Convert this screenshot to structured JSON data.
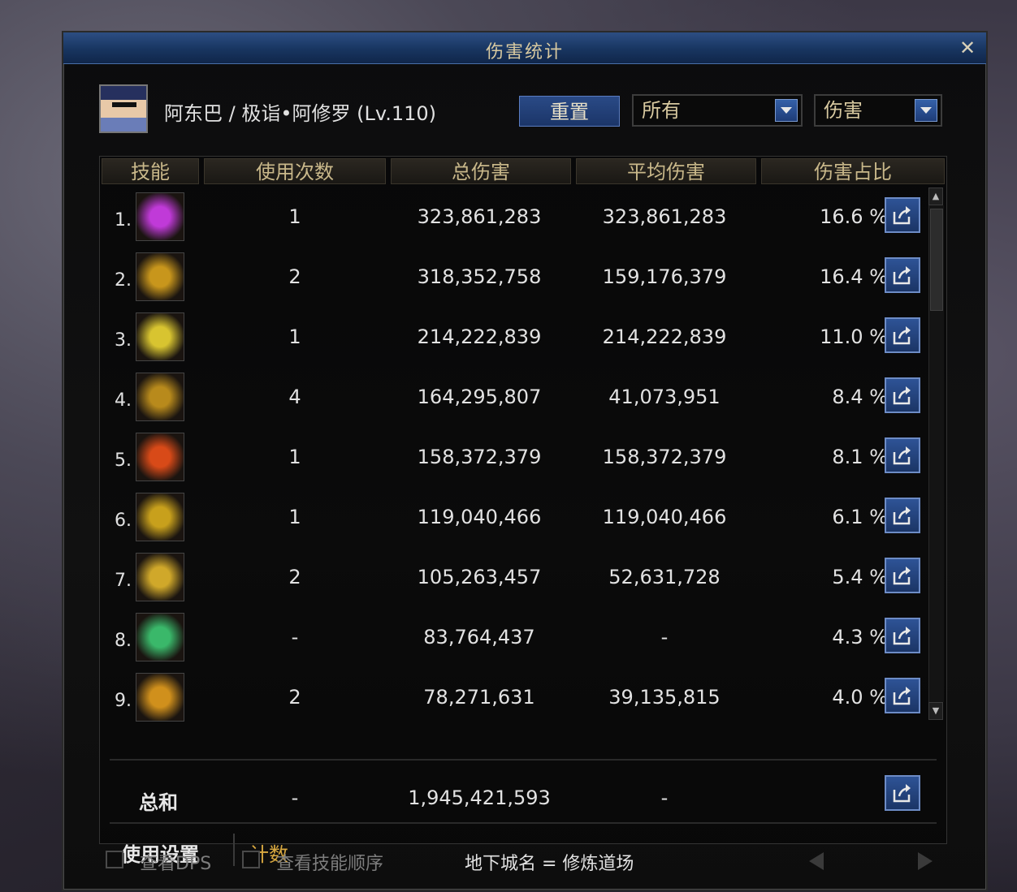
{
  "window": {
    "title": "伤害统计",
    "close_label": "✕"
  },
  "header": {
    "character": "阿东巴 / 极诣•阿修罗 (Lv.110)",
    "reset_label": "重置",
    "filter_select": "所有",
    "metric_select": "伤害"
  },
  "columns": [
    "技能",
    "使用次数",
    "总伤害",
    "平均伤害",
    "伤害占比"
  ],
  "rows": [
    {
      "num": "1.",
      "uses": "1",
      "total": "323,861,283",
      "avg": "323,861,283",
      "pct": "16.6 %",
      "icon": "purple-burst-skill-icon",
      "color": "#c03ad8"
    },
    {
      "num": "2.",
      "uses": "2",
      "total": "318,352,758",
      "avg": "159,176,379",
      "pct": "16.4 %",
      "icon": "golden-swirl-skill-icon",
      "color": "#c8961c"
    },
    {
      "num": "3.",
      "uses": "1",
      "total": "214,222,839",
      "avg": "214,222,839",
      "pct": "11.0 %",
      "icon": "lightning-cloud-skill-icon",
      "color": "#d8c430"
    },
    {
      "num": "4.",
      "uses": "4",
      "total": "164,295,807",
      "avg": "41,073,951",
      "pct": "8.4 %",
      "icon": "golden-arrow-skill-icon",
      "color": "#b88a1c"
    },
    {
      "num": "5.",
      "uses": "1",
      "total": "158,372,379",
      "avg": "158,372,379",
      "pct": "8.1 %",
      "icon": "fire-glyph-skill-icon",
      "color": "#d84a18"
    },
    {
      "num": "6.",
      "uses": "1",
      "total": "119,040,466",
      "avg": "119,040,466",
      "pct": "6.1 %",
      "icon": "golden-ring-skill-icon",
      "color": "#c8a01c"
    },
    {
      "num": "7.",
      "uses": "2",
      "total": "105,263,457",
      "avg": "52,631,728",
      "pct": "5.4 %",
      "icon": "golden-crown-skill-icon",
      "color": "#d0a82a"
    },
    {
      "num": "8.",
      "uses": "-",
      "total": "83,764,437",
      "avg": "-",
      "pct": "4.3 %",
      "icon": "green-lightning-skill-icon",
      "color": "#3ab86a"
    },
    {
      "num": "9.",
      "uses": "2",
      "total": "78,271,631",
      "avg": "39,135,815",
      "pct": "4.0 %",
      "icon": "orange-vortex-skill-icon",
      "color": "#d0901c"
    }
  ],
  "summary": {
    "label": "总和",
    "uses": "-",
    "total": "1,945,421,593",
    "avg": "-"
  },
  "tabs": {
    "settings": "使用设置",
    "count": "计数"
  },
  "footer": {
    "dps_label": "查看DPS",
    "order_label": "查看技能顺序",
    "dungeon": "地下城名 = 修炼道场"
  }
}
